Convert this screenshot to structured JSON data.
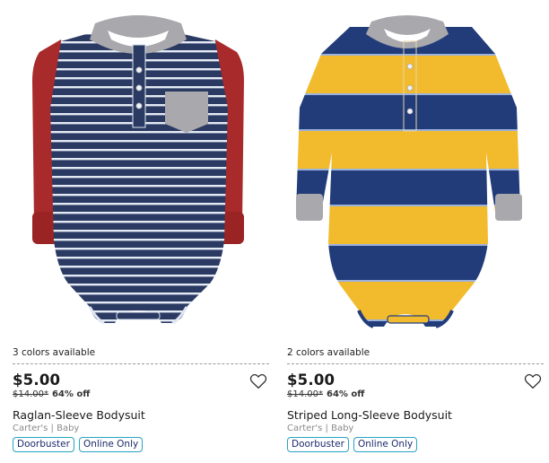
{
  "products": [
    {
      "colors_available": "3 colors available",
      "price": "$5.00",
      "original_price": "$14.00*",
      "discount": "64% off",
      "name": "Raglan-Sleeve Bodysuit",
      "brand": "Carter's | Baby",
      "badges": [
        "Doorbuster",
        "Online Only"
      ],
      "palette": {
        "body": "#2b3a63",
        "stripe": "#dfe6f2",
        "sleeve": "#a82a2a",
        "trim": "#a9a9ad"
      }
    },
    {
      "colors_available": "2 colors available",
      "price": "$5.00",
      "original_price": "$14.00*",
      "discount": "64% off",
      "name": "Striped Long-Sleeve Bodysuit",
      "brand": "Carter's | Baby",
      "badges": [
        "Doorbuster",
        "Online Only"
      ],
      "palette": {
        "navy": "#223c7a",
        "yellow": "#f2bb2e",
        "trim": "#a9a9ad"
      }
    }
  ],
  "icons": {
    "favorite": "heart-outline-icon"
  }
}
